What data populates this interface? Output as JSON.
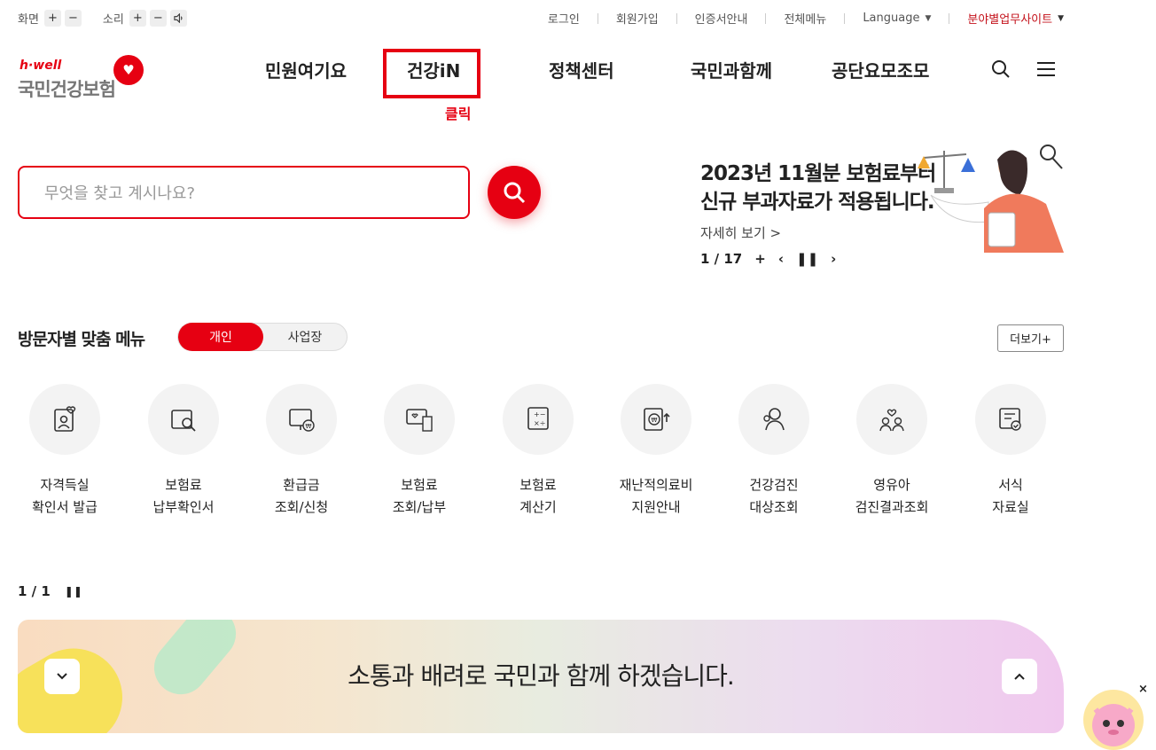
{
  "util": {
    "screen_label": "화면",
    "sound_label": "소리",
    "plus": "+",
    "minus": "−",
    "links": [
      "로그인",
      "회원가입",
      "인증서안내",
      "전체메뉴"
    ],
    "language": "Language",
    "business_sites": "분야별업무사이트"
  },
  "logo": {
    "sub": "h·well",
    "main": "국민건강보험"
  },
  "gnb": {
    "items": [
      "민원여기요",
      "건강iN",
      "정책센터",
      "국민과함께",
      "공단요모조모"
    ],
    "click_annotation": "클릭",
    "highlight_color": "#e60012"
  },
  "search": {
    "placeholder": "무엇을 찾고 계시나요?"
  },
  "banner": {
    "line1": "2023년 11월분 보험료부터",
    "line2": "신규 부과자료가 적용됩니다.",
    "more": "자세히 보기 >",
    "page": "1 / 17",
    "plus": "+"
  },
  "visitor": {
    "title": "방문자별 맞춤 메뉴",
    "tab_on": "개인",
    "tab_off": "사업장",
    "more": "더보기+",
    "items": [
      {
        "l1": "자격득실",
        "l2": "확인서 발급",
        "icon": "id-card-heart-icon"
      },
      {
        "l1": "보험료",
        "l2": "납부확인서",
        "icon": "document-search-icon"
      },
      {
        "l1": "환급금",
        "l2": "조회/신청",
        "icon": "monitor-won-icon"
      },
      {
        "l1": "보험료",
        "l2": "조회/납부",
        "icon": "monitor-receipt-icon"
      },
      {
        "l1": "보험료",
        "l2": "계산기",
        "icon": "calculator-icon"
      },
      {
        "l1": "재난적의료비",
        "l2": "지원안내",
        "icon": "book-won-icon"
      },
      {
        "l1": "건강검진",
        "l2": "대상조회",
        "icon": "people-search-icon"
      },
      {
        "l1": "영유아",
        "l2": "검진결과조회",
        "icon": "family-heart-icon"
      },
      {
        "l1": "서식",
        "l2": "자료실",
        "icon": "form-document-icon"
      }
    ],
    "pager": "1 / 1"
  },
  "bottom_banner": {
    "text": "소통과 배려로 국민과 함께 하겠습니다."
  },
  "colors": {
    "brand": "#e60012"
  }
}
